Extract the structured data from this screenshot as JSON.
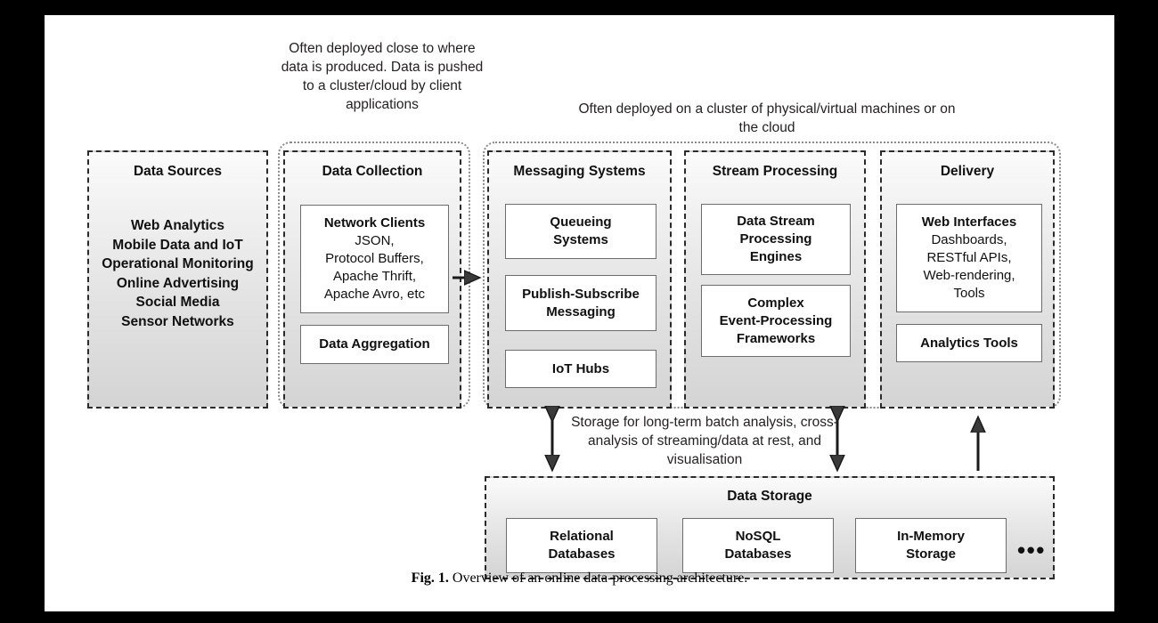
{
  "figure": {
    "caption_label": "Fig. 1.",
    "caption_text": "Overview of an online data-processing architecture."
  },
  "annotations": {
    "collection_note": "Often deployed close to where data is produced. Data is pushed to a cluster/cloud by client applications",
    "cluster_note": "Often deployed on a cluster of physical/virtual machines or on the cloud",
    "storage_note": "Storage for long-term batch analysis, cross-analysis of streaming/data at rest, and visualisation"
  },
  "columns": {
    "data_sources": {
      "title": "Data Sources",
      "items_text": "Web Analytics\nMobile Data and IoT\nOperational Monitoring\nOnline Advertising\nSocial Media\nSensor Networks"
    },
    "data_collection": {
      "title": "Data Collection",
      "network_clients_header": "Network Clients",
      "network_clients_body": "JSON,\nProtocol Buffers,\nApache Thrift,\nApache Avro, etc",
      "data_aggregation": "Data Aggregation"
    },
    "messaging_systems": {
      "title": "Messaging Systems",
      "queueing": "Queueing\nSystems",
      "pubsub": "Publish-Subscribe\nMessaging",
      "iot_hubs": "IoT Hubs"
    },
    "stream_processing": {
      "title": "Stream Processing",
      "engines": "Data Stream\nProcessing\nEngines",
      "cep": "Complex\nEvent-Processing\nFrameworks"
    },
    "delivery": {
      "title": "Delivery",
      "web_interfaces_header": "Web Interfaces",
      "web_interfaces_body": "Dashboards,\nRESTful APIs,\nWeb-rendering,\nTools",
      "analytics_tools": "Analytics Tools"
    },
    "data_storage": {
      "title": "Data Storage",
      "relational": "Relational\nDatabases",
      "nosql": "NoSQL\nDatabases",
      "inmemory": "In-Memory\nStorage",
      "more": "•••"
    }
  },
  "colors": {
    "page_background": "#ffffff",
    "letterbox": "#000000",
    "column_border": "#2b2b2b",
    "group_border": "#8a8a8a",
    "box_border": "#6d6d6d",
    "box_fill": "#ffffff",
    "arrow": "#1a1a1a",
    "text": "#101010"
  }
}
